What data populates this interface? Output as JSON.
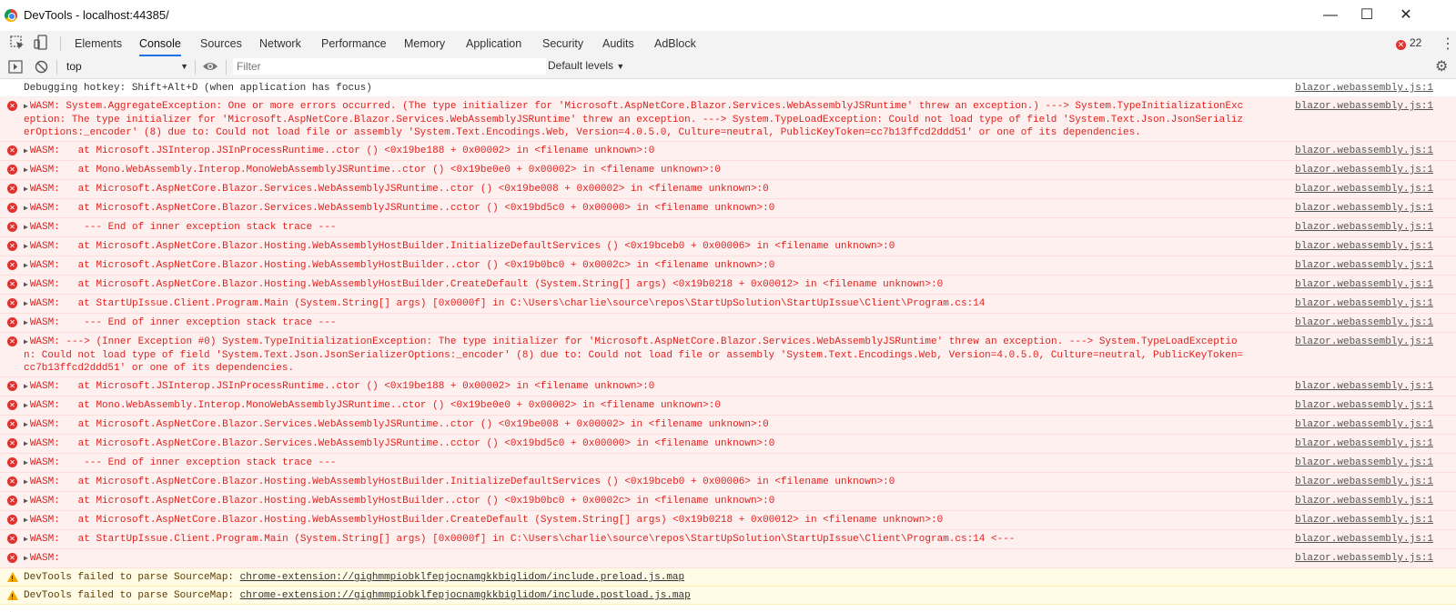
{
  "window": {
    "title": "DevTools - localhost:44385/",
    "minimize_icon": "minimize-icon",
    "maximize_icon": "maximize-icon",
    "close_icon": "close-icon"
  },
  "tabs": [
    {
      "label": "Elements"
    },
    {
      "label": "Console"
    },
    {
      "label": "Sources"
    },
    {
      "label": "Network"
    },
    {
      "label": "Performance"
    },
    {
      "label": "Memory"
    },
    {
      "label": "Application"
    },
    {
      "label": "Security"
    },
    {
      "label": "Audits"
    },
    {
      "label": "AdBlock"
    }
  ],
  "active_tab": "Console",
  "error_count": "22",
  "toolbar": {
    "context": "top",
    "filter_placeholder": "Filter",
    "levels": "Default levels"
  },
  "colors": {
    "error_bg": "#fff0f0",
    "error_text": "#e0211d",
    "warn_bg": "#fffbe5",
    "accent": "#1a73e8"
  },
  "source_link": "blazor.webassembly.js:1",
  "messages": [
    {
      "level": "info",
      "text": "Debugging hotkey: Shift+Alt+D (when application has focus)",
      "source": "blazor.webassembly.js:1"
    },
    {
      "level": "error",
      "text": "WASM: System.AggregateException: One or more errors occurred. (The type initializer for 'Microsoft.AspNetCore.Blazor.Services.WebAssemblyJSRuntime' threw an exception.) ---> System.TypeInitializationException: The type initializer for 'Microsoft.AspNetCore.Blazor.Services.WebAssemblyJSRuntime' threw an exception. ---> System.TypeLoadException: Could not load type of field 'System.Text.Json.JsonSerializerOptions:_encoder' (8) due to: Could not load file or assembly 'System.Text.Encodings.Web, Version=4.0.5.0, Culture=neutral, PublicKeyToken=cc7b13ffcd2ddd51' or one of its dependencies.",
      "source": "blazor.webassembly.js:1"
    },
    {
      "level": "error",
      "text": "WASM:   at Microsoft.JSInterop.JSInProcessRuntime..ctor () <0x19be188 + 0x00002> in <filename unknown>:0",
      "source": "blazor.webassembly.js:1"
    },
    {
      "level": "error",
      "text": "WASM:   at Mono.WebAssembly.Interop.MonoWebAssemblyJSRuntime..ctor () <0x19be0e0 + 0x00002> in <filename unknown>:0",
      "source": "blazor.webassembly.js:1"
    },
    {
      "level": "error",
      "text": "WASM:   at Microsoft.AspNetCore.Blazor.Services.WebAssemblyJSRuntime..ctor () <0x19be008 + 0x00002> in <filename unknown>:0",
      "source": "blazor.webassembly.js:1"
    },
    {
      "level": "error",
      "text": "WASM:   at Microsoft.AspNetCore.Blazor.Services.WebAssemblyJSRuntime..cctor () <0x19bd5c0 + 0x00000> in <filename unknown>:0",
      "source": "blazor.webassembly.js:1"
    },
    {
      "level": "error",
      "text": "WASM:    --- End of inner exception stack trace ---",
      "source": "blazor.webassembly.js:1"
    },
    {
      "level": "error",
      "text": "WASM:   at Microsoft.AspNetCore.Blazor.Hosting.WebAssemblyHostBuilder.InitializeDefaultServices () <0x19bceb0 + 0x00006> in <filename unknown>:0",
      "source": "blazor.webassembly.js:1"
    },
    {
      "level": "error",
      "text": "WASM:   at Microsoft.AspNetCore.Blazor.Hosting.WebAssemblyHostBuilder..ctor () <0x19b0bc0 + 0x0002c> in <filename unknown>:0",
      "source": "blazor.webassembly.js:1"
    },
    {
      "level": "error",
      "text": "WASM:   at Microsoft.AspNetCore.Blazor.Hosting.WebAssemblyHostBuilder.CreateDefault (System.String[] args) <0x19b0218 + 0x00012> in <filename unknown>:0",
      "source": "blazor.webassembly.js:1"
    },
    {
      "level": "error",
      "text": "WASM:   at StartUpIssue.Client.Program.Main (System.String[] args) [0x0000f] in C:\\Users\\charlie\\source\\repos\\StartUpSolution\\StartUpIssue\\Client\\Program.cs:14",
      "source": "blazor.webassembly.js:1"
    },
    {
      "level": "error",
      "text": "WASM:    --- End of inner exception stack trace ---",
      "source": "blazor.webassembly.js:1"
    },
    {
      "level": "error",
      "text": "WASM: ---> (Inner Exception #0) System.TypeInitializationException: The type initializer for 'Microsoft.AspNetCore.Blazor.Services.WebAssemblyJSRuntime' threw an exception. ---> System.TypeLoadException: Could not load type of field 'System.Text.Json.JsonSerializerOptions:_encoder' (8) due to: Could not load file or assembly 'System.Text.Encodings.Web, Version=4.0.5.0, Culture=neutral, PublicKeyToken=cc7b13ffcd2ddd51' or one of its dependencies.",
      "source": "blazor.webassembly.js:1"
    },
    {
      "level": "error",
      "text": "WASM:   at Microsoft.JSInterop.JSInProcessRuntime..ctor () <0x19be188 + 0x00002> in <filename unknown>:0",
      "source": "blazor.webassembly.js:1"
    },
    {
      "level": "error",
      "text": "WASM:   at Mono.WebAssembly.Interop.MonoWebAssemblyJSRuntime..ctor () <0x19be0e0 + 0x00002> in <filename unknown>:0",
      "source": "blazor.webassembly.js:1"
    },
    {
      "level": "error",
      "text": "WASM:   at Microsoft.AspNetCore.Blazor.Services.WebAssemblyJSRuntime..ctor () <0x19be008 + 0x00002> in <filename unknown>:0",
      "source": "blazor.webassembly.js:1"
    },
    {
      "level": "error",
      "text": "WASM:   at Microsoft.AspNetCore.Blazor.Services.WebAssemblyJSRuntime..cctor () <0x19bd5c0 + 0x00000> in <filename unknown>:0",
      "source": "blazor.webassembly.js:1"
    },
    {
      "level": "error",
      "text": "WASM:    --- End of inner exception stack trace ---",
      "source": "blazor.webassembly.js:1"
    },
    {
      "level": "error",
      "text": "WASM:   at Microsoft.AspNetCore.Blazor.Hosting.WebAssemblyHostBuilder.InitializeDefaultServices () <0x19bceb0 + 0x00006> in <filename unknown>:0",
      "source": "blazor.webassembly.js:1"
    },
    {
      "level": "error",
      "text": "WASM:   at Microsoft.AspNetCore.Blazor.Hosting.WebAssemblyHostBuilder..ctor () <0x19b0bc0 + 0x0002c> in <filename unknown>:0",
      "source": "blazor.webassembly.js:1"
    },
    {
      "level": "error",
      "text": "WASM:   at Microsoft.AspNetCore.Blazor.Hosting.WebAssemblyHostBuilder.CreateDefault (System.String[] args) <0x19b0218 + 0x00012> in <filename unknown>:0",
      "source": "blazor.webassembly.js:1"
    },
    {
      "level": "error",
      "text": "WASM:   at StartUpIssue.Client.Program.Main (System.String[] args) [0x0000f] in C:\\Users\\charlie\\source\\repos\\StartUpSolution\\StartUpIssue\\Client\\Program.cs:14 <---",
      "source": "blazor.webassembly.js:1"
    },
    {
      "level": "error",
      "text": "WASM:",
      "source": "blazor.webassembly.js:1"
    },
    {
      "level": "warn",
      "text": "DevTools failed to parse SourceMap: ",
      "link": "chrome-extension://gighmmpiobklfepjocnamgkkbiglidom/include.preload.js.map"
    },
    {
      "level": "warn",
      "text": "DevTools failed to parse SourceMap: ",
      "link": "chrome-extension://gighmmpiobklfepjocnamgkkbiglidom/include.postload.js.map"
    }
  ]
}
